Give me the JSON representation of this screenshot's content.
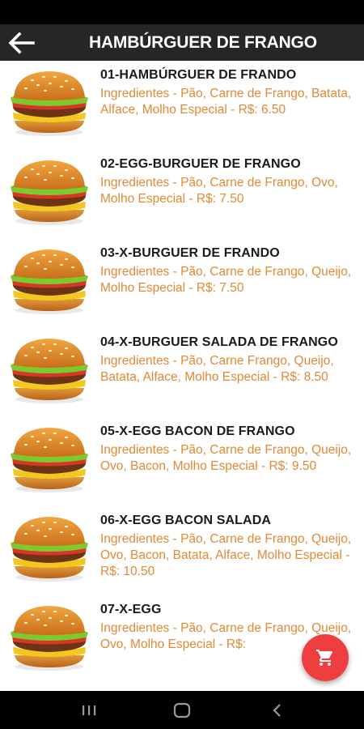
{
  "app_bar": {
    "title": "HAMBÚRGUER DE FRANGO",
    "back_icon": "arrow-left-icon",
    "background": "#262626"
  },
  "colors": {
    "description": "#e08a35",
    "fab": "#ef3e3e"
  },
  "items": [
    {
      "name": "01-HAMBÚRGUER DE FRANDO",
      "description": "Ingredientes - Pão, Carne de Frango, Batata, Alface, Molho Especial - R$: 6.50"
    },
    {
      "name": "02-EGG-BURGUER DE FRANGO",
      "description": "Ingredientes - Pão, Carne de Frango, Ovo, Molho Especial - R$: 7.50"
    },
    {
      "name": "03-X-BURGUER DE FRANDO",
      "description": "Ingredientes - Pão, Carne de Frango, Queijo, Molho Especial - R$: 7.50"
    },
    {
      "name": "04-X-BURGUER SALADA DE FRANGO",
      "description": "Ingredientes - Pão, Carne Frango, Queijo, Batata, Alface, Molho Especial - R$: 8.50"
    },
    {
      "name": "05-X-EGG BACON DE FRANGO",
      "description": "Ingredientes - Pão, Carne de Frango, Queijo, Ovo, Bacon, Molho Especial - R$: 9.50"
    },
    {
      "name": "06-X-EGG BACON SALADA",
      "description": "Ingredientes - Pão, Carne de Frango, Queijo, Ovo, Bacon, Batata, Alface, Molho Especial - R$: 10.50"
    },
    {
      "name": "07-X-EGG",
      "description": "Ingredientes - Pão, Carne de Frango, Queijo, Ovo, Molho Especial - R$:"
    }
  ],
  "fab": {
    "icon": "shopping-cart-icon"
  },
  "nav_bar": {
    "icons": [
      "recent-apps-icon",
      "home-icon",
      "back-nav-icon"
    ]
  }
}
